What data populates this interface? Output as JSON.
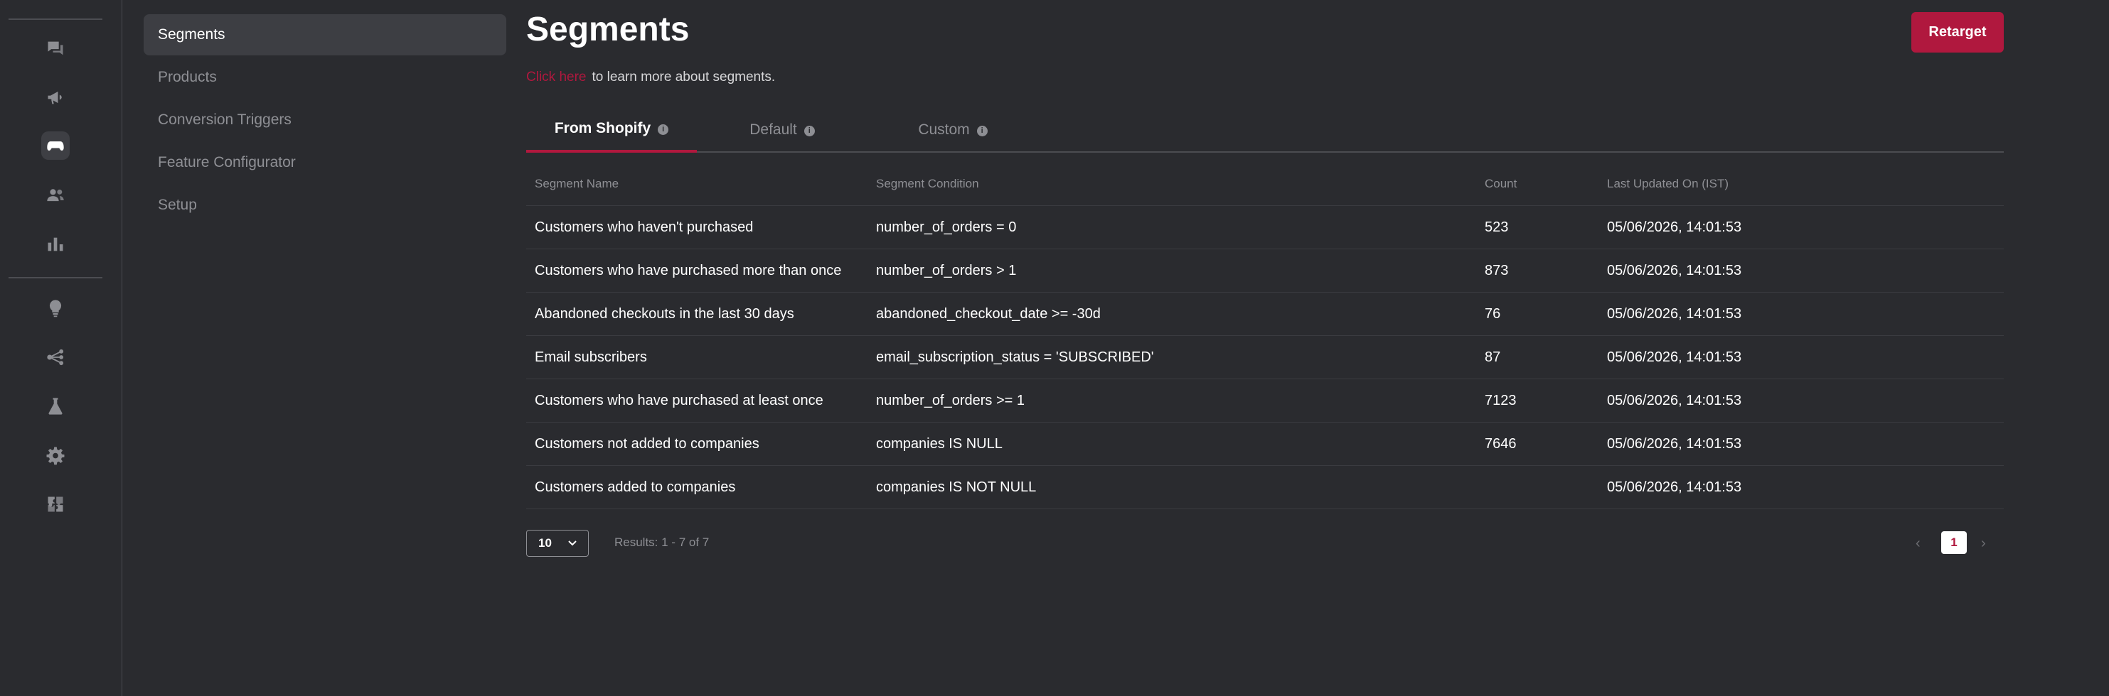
{
  "subnav": {
    "items": [
      {
        "label": "Segments"
      },
      {
        "label": "Products"
      },
      {
        "label": "Conversion Triggers"
      },
      {
        "label": "Feature Configurator"
      },
      {
        "label": "Setup"
      }
    ]
  },
  "header": {
    "title": "Segments",
    "retarget_label": "Retarget",
    "learn_link": "Click here",
    "learn_text": "to learn more about segments."
  },
  "tabs": [
    {
      "label": "From Shopify"
    },
    {
      "label": "Default"
    },
    {
      "label": "Custom"
    }
  ],
  "info_icon_glyph": "i",
  "table": {
    "columns": [
      "Segment Name",
      "Segment Condition",
      "Count",
      "Last Updated On (IST)"
    ],
    "rows": [
      {
        "name": "Customers who haven't purchased",
        "condition": "number_of_orders = 0",
        "count": "523",
        "updated": "05/06/2026, 14:01:53"
      },
      {
        "name": "Customers who have purchased more than once",
        "condition": "number_of_orders > 1",
        "count": "873",
        "updated": "05/06/2026, 14:01:53"
      },
      {
        "name": "Abandoned checkouts in the last 30 days",
        "condition": "abandoned_checkout_date >= -30d",
        "count": "76",
        "updated": "05/06/2026, 14:01:53"
      },
      {
        "name": "Email subscribers",
        "condition": "email_subscription_status = 'SUBSCRIBED'",
        "count": "87",
        "updated": "05/06/2026, 14:01:53"
      },
      {
        "name": "Customers who have purchased at least once",
        "condition": "number_of_orders >= 1",
        "count": "7123",
        "updated": "05/06/2026, 14:01:53"
      },
      {
        "name": "Customers not added to companies",
        "condition": "companies IS NULL",
        "count": "7646",
        "updated": "05/06/2026, 14:01:53"
      },
      {
        "name": "Customers added to companies",
        "condition": "companies IS NOT NULL",
        "count": "",
        "updated": "05/06/2026, 14:01:53"
      }
    ]
  },
  "pagination": {
    "page_size": "10",
    "results": "Results: 1 - 7 of 7",
    "current_page": "1",
    "prev_glyph": "‹",
    "next_glyph": "›"
  },
  "colors": {
    "accent": "#b0183e",
    "background": "#2a2b2f",
    "muted_text": "#8e8f94"
  },
  "rail_icons": [
    "chat-icon",
    "megaphone-icon",
    "gamepad-icon",
    "users-icon",
    "bar-chart-icon",
    "lightbulb-icon",
    "share-nodes-icon",
    "flask-icon",
    "gear-icon",
    "puzzle-icon"
  ]
}
